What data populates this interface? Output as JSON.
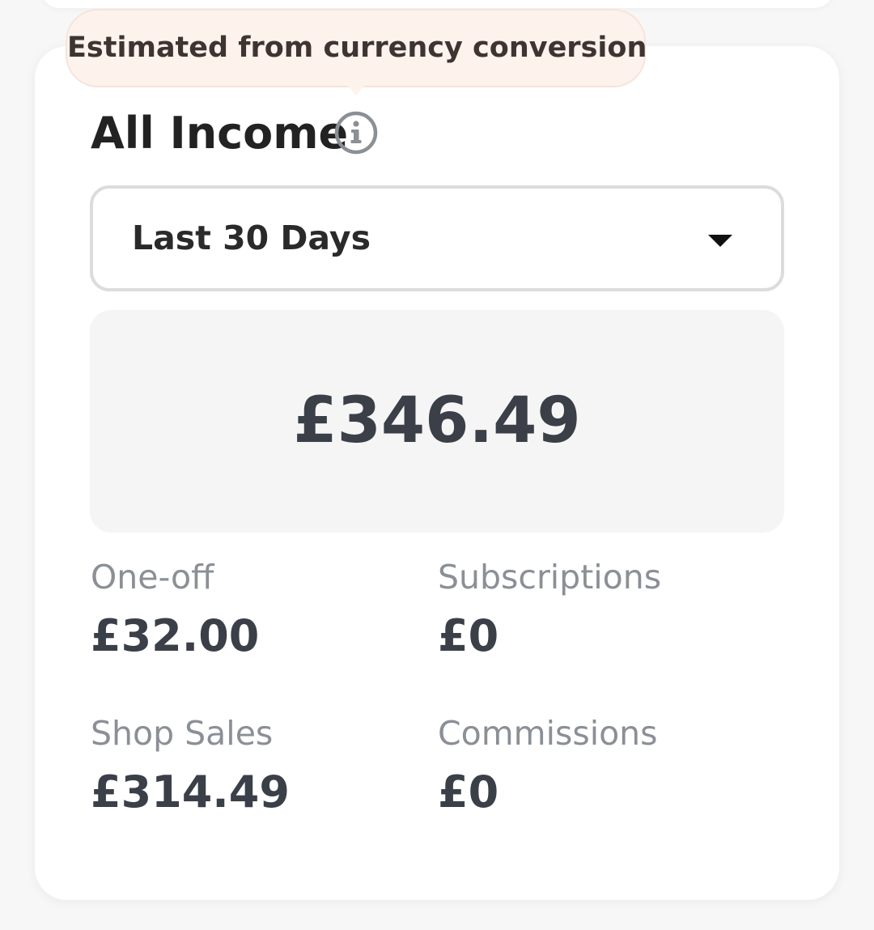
{
  "tooltip": {
    "text": "Estimated from currency conversion"
  },
  "card": {
    "title": "All Income",
    "info_icon": "info-circle-icon"
  },
  "period_select": {
    "selected": "Last 30 Days",
    "icon": "caret-down-icon"
  },
  "total": {
    "amount": "£346.49"
  },
  "breakdown": [
    {
      "label": "One-off",
      "value": "£32.00"
    },
    {
      "label": "Subscriptions",
      "value": "£0"
    },
    {
      "label": "Shop Sales",
      "value": "£314.49"
    },
    {
      "label": "Commissions",
      "value": "£0"
    }
  ],
  "colors": {
    "tooltip_bg": "#fdf2ec",
    "total_box_bg": "#f5f5f5",
    "label_gray": "#8b8f96",
    "value_dark": "#3a3f48"
  }
}
